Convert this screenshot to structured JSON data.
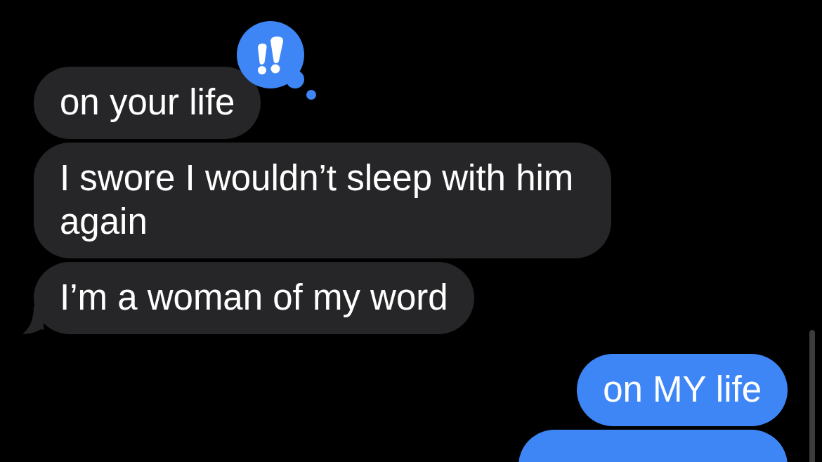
{
  "messages": [
    {
      "kind": "received",
      "text": "on your life",
      "emphasized": true,
      "tail": false
    },
    {
      "kind": "received",
      "text": "I swore I wouldn’t sleep with him again",
      "emphasized": false,
      "tail": false
    },
    {
      "kind": "received",
      "text": "I’m a woman of my word",
      "emphasized": false,
      "tail": true
    },
    {
      "kind": "sent",
      "text": "on MY life",
      "emphasized": false,
      "tail": false
    },
    {
      "kind": "sent",
      "emphasized": false,
      "tail": false
    }
  ]
}
